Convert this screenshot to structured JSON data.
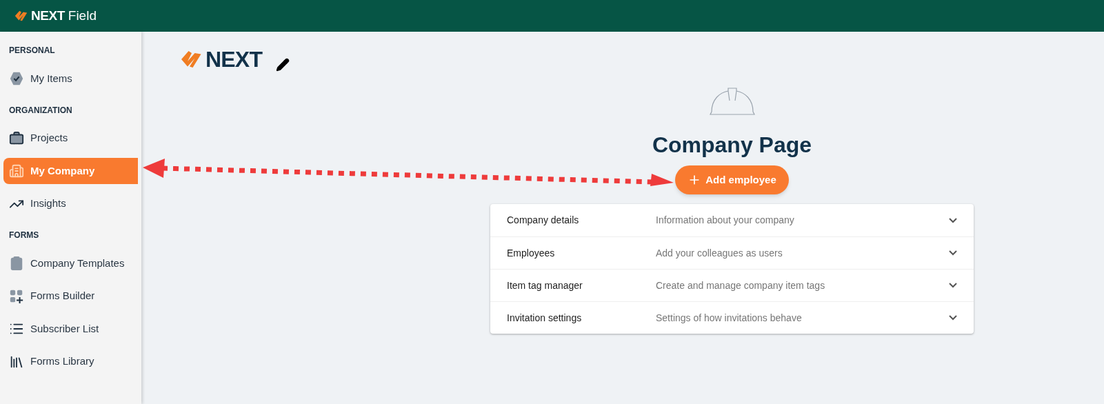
{
  "header": {
    "logo_text": "NEXT",
    "app_name": "Field"
  },
  "sidebar": {
    "sections": [
      {
        "title": "PERSONAL",
        "items": [
          {
            "label": "My Items",
            "selected": false
          }
        ]
      },
      {
        "title": "ORGANIZATION",
        "items": [
          {
            "label": "Projects",
            "selected": false
          },
          {
            "label": "My Company",
            "selected": true
          },
          {
            "label": "Insights",
            "selected": false
          }
        ]
      },
      {
        "title": "FORMS",
        "items": [
          {
            "label": "Company Templates",
            "selected": false
          },
          {
            "label": "Forms Builder",
            "selected": false
          },
          {
            "label": "Subscriber List",
            "selected": false
          },
          {
            "label": "Forms Library",
            "selected": false
          }
        ]
      }
    ]
  },
  "company": {
    "logo_text": "NEXT",
    "title": "Company Page",
    "add_button": "Add employee"
  },
  "panels": [
    {
      "title": "Company details",
      "description": "Information about your company",
      "expanded": false
    },
    {
      "title": "Employees",
      "description": "Add your colleagues as users",
      "expanded": false
    },
    {
      "title": "Item tag manager",
      "description": "Create and manage company item tags",
      "expanded": false
    },
    {
      "title": "Invitation settings",
      "description": "Settings of how invitations behave",
      "expanded": false
    }
  ]
}
